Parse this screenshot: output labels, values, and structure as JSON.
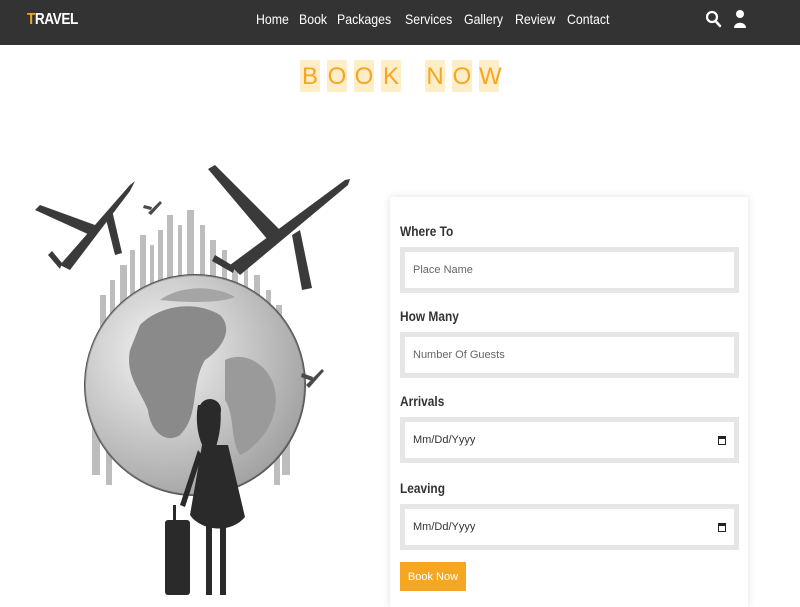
{
  "logo": {
    "first_letter": "T",
    "rest": "RAVEL"
  },
  "nav": {
    "links": [
      "Home",
      "Book",
      "Packages",
      "Services",
      "Gallery",
      "Review",
      "Contact"
    ]
  },
  "icons": {
    "search": "search-icon",
    "user": "user-icon"
  },
  "heading": {
    "letters": [
      "B",
      "O",
      "O",
      "K",
      " ",
      "N",
      "O",
      "W"
    ]
  },
  "form": {
    "where_label": "Where To",
    "where_placeholder": "Place Name",
    "guests_label": "How Many",
    "guests_placeholder": "Number Of Guests",
    "arrivals_label": "Arrivals",
    "arrivals_value": "Mm/Dd/Yyyy",
    "leaving_label": "Leaving",
    "leaving_value": "Mm/Dd/Yyyy",
    "submit_label": "Book Now"
  },
  "colors": {
    "accent": "#f5a623",
    "navbar": "#333333",
    "heading_bg": "#fdeec8",
    "field_frame": "#e6e6e6"
  }
}
